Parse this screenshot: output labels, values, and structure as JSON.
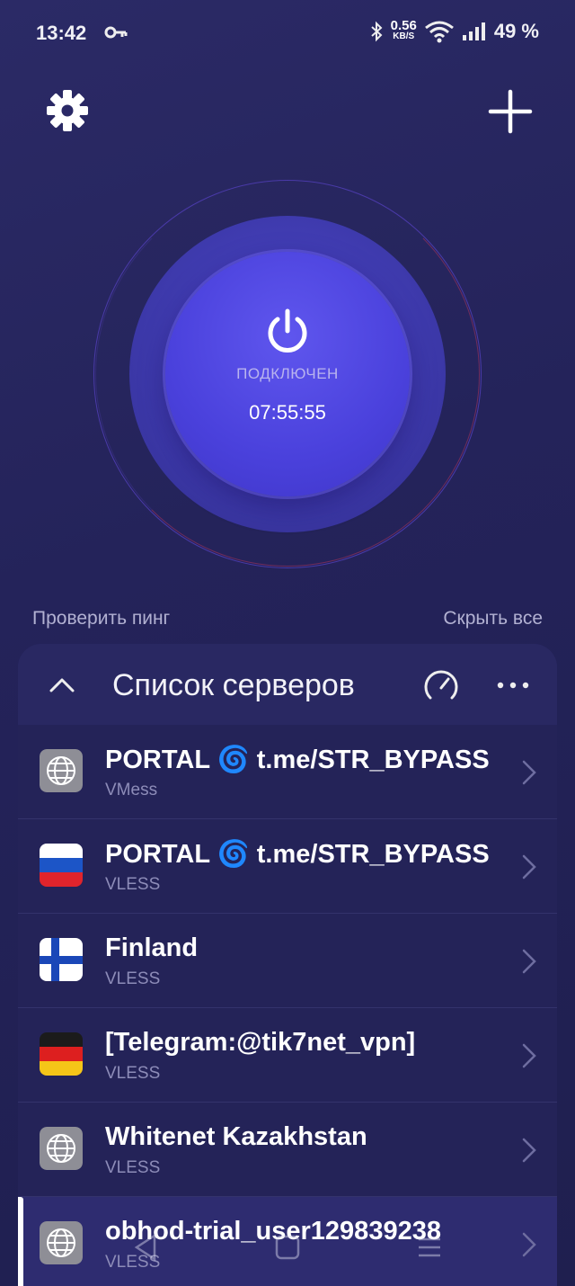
{
  "status_bar": {
    "time": "13:42",
    "net_speed_value": "0.56",
    "net_speed_unit": "KB/S",
    "battery": "49 %"
  },
  "toolbar": {
    "settings_icon": "gear-icon",
    "add_icon": "plus-icon"
  },
  "connection": {
    "status": "ПОДКЛЮЧЕН",
    "timer": "07:55:55",
    "power_icon": "power-icon"
  },
  "actions": {
    "check_ping": "Проверить пинг",
    "hide_all": "Скрыть все"
  },
  "server_panel": {
    "title": "Список серверов",
    "servers": [
      {
        "name": "PORTAL 🌀 t.me/STR_BYPASS",
        "protocol": "VMess",
        "flag": "globe"
      },
      {
        "name": "PORTAL 🌀 t.me/STR_BYPASS",
        "protocol": "VLESS",
        "flag": "russia"
      },
      {
        "name": "Finland",
        "protocol": "VLESS",
        "flag": "finland"
      },
      {
        "name": "[Telegram:@tik7net_vpn]",
        "protocol": "VLESS",
        "flag": "germany"
      },
      {
        "name": "Whitenet Kazakhstan",
        "protocol": "VLESS",
        "flag": "globe"
      },
      {
        "name": "obhod-trial_user129839238",
        "protocol": "VLESS",
        "flag": "globe"
      }
    ]
  },
  "colors": {
    "background": "#24235a",
    "accent": "#4a41dc",
    "panel": "#2a2966"
  }
}
